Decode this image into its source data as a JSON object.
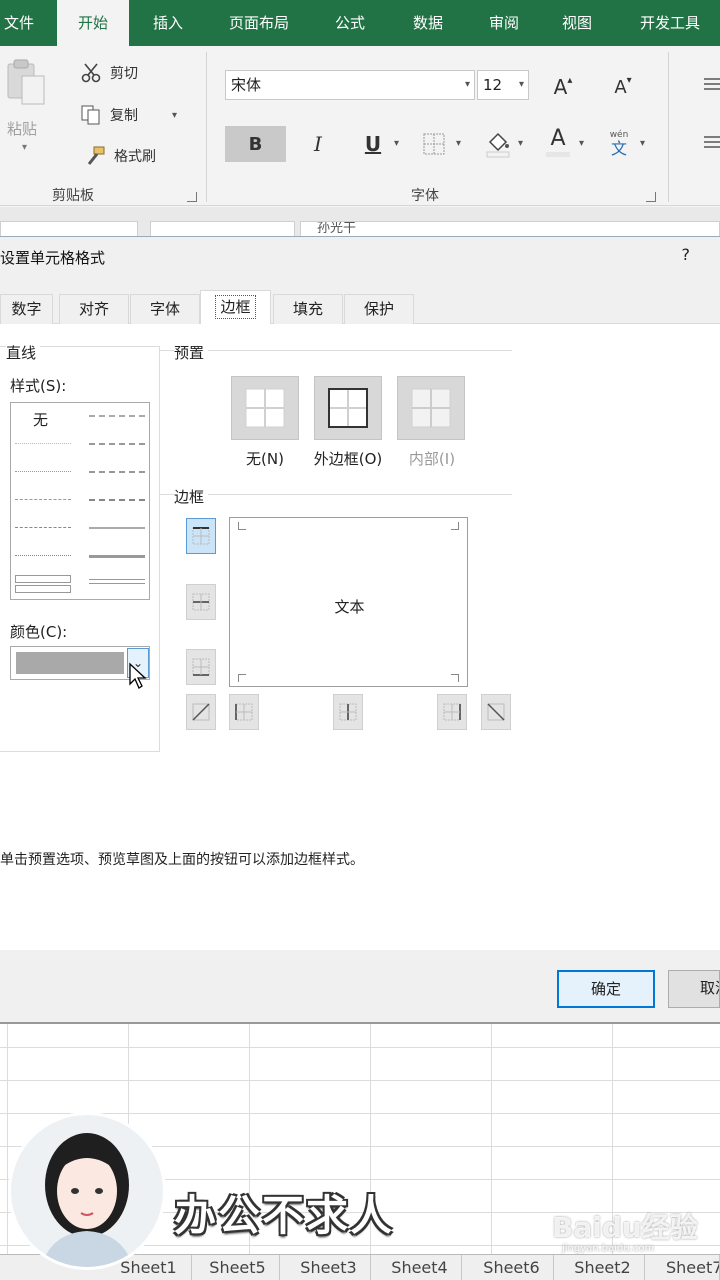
{
  "ribbon_tabs": [
    "文件",
    "开始",
    "插入",
    "页面布局",
    "公式",
    "数据",
    "审阅",
    "视图",
    "开发工具"
  ],
  "clipboard": {
    "paste_label": "粘贴",
    "cut_label": "剪切",
    "copy_label": "复制",
    "format_painter_label": "格式刷",
    "group_label": "剪贴板"
  },
  "font": {
    "font_name": "宋体",
    "font_size": "12",
    "grow_label": "A",
    "shrink_label": "A",
    "bold_label": "B",
    "italic_label": "I",
    "underline_label": "U",
    "color_label": "A",
    "phonetic_label": "wén",
    "phonetic_char": "文",
    "group_label": "字体"
  },
  "formula_bar_fragment": "孙光干",
  "dialog": {
    "title": "设置单元格格式",
    "help": "?",
    "tabs": [
      "数字",
      "对齐",
      "字体",
      "边框",
      "填充",
      "保护"
    ],
    "active_tab": "边框",
    "line_section": "直线",
    "style_label": "样式(S):",
    "style_none": "无",
    "color_label": "颜色(C):",
    "preset_section": "预置",
    "presets": [
      {
        "label": "无(N)",
        "enabled": true
      },
      {
        "label": "外边框(O)",
        "enabled": true
      },
      {
        "label": "内部(I)",
        "enabled": false
      }
    ],
    "border_section": "边框",
    "preview_text": "文本",
    "hint": "单击预置选项、预览草图及上面的按钮可以添加边框样式。",
    "ok_label": "确定",
    "cancel_label": "取消"
  },
  "sheet_tabs": [
    "Sheet1",
    "Sheet5",
    "Sheet3",
    "Sheet4",
    "Sheet6",
    "Sheet2",
    "Sheet7"
  ],
  "caption": "办公不求人",
  "watermark": "Baidu经验",
  "watermark_sub": "jingyan.baidu.com",
  "colors": {
    "ribbon_green": "#217346",
    "accent_blue": "#0078d7",
    "swatch_gray": "#a9a9a9"
  }
}
